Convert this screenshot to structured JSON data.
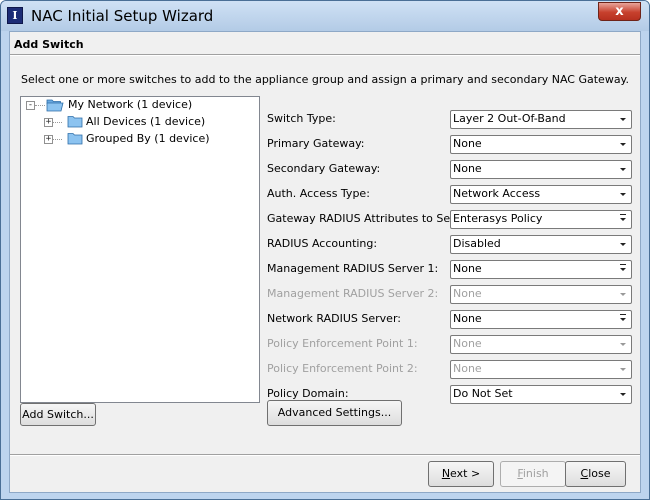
{
  "window": {
    "title": "NAC Initial Setup Wizard",
    "close_glyph": "x"
  },
  "header": {
    "title": "Add Switch"
  },
  "instructions": "Select one or more switches to add to the appliance group and assign a primary and secondary NAC Gateway.",
  "tree": {
    "root": {
      "label": "My Network (1 device)",
      "expander": "-"
    },
    "children": [
      {
        "label": "All Devices (1 device)",
        "expander": "+"
      },
      {
        "label": "Grouped By (1 device)",
        "expander": "+"
      }
    ]
  },
  "fields": [
    {
      "label": "Switch Type:",
      "value": "Layer 2 Out-Of-Band",
      "enabled": true
    },
    {
      "label": "Primary Gateway:",
      "value": "None",
      "enabled": true
    },
    {
      "label": "Secondary Gateway:",
      "value": "None",
      "enabled": true
    },
    {
      "label": "Auth. Access Type:",
      "value": "Network Access",
      "enabled": true
    },
    {
      "label": "Gateway RADIUS Attributes to Send:",
      "value": "Enterasys Policy",
      "enabled": true
    },
    {
      "label": "RADIUS Accounting:",
      "value": "Disabled",
      "enabled": true
    },
    {
      "label": "Management RADIUS Server 1:",
      "value": "None",
      "enabled": true
    },
    {
      "label": "Management RADIUS Server 2:",
      "value": "None",
      "enabled": false
    },
    {
      "label": "Network RADIUS Server:",
      "value": "None",
      "enabled": true
    },
    {
      "label": "Policy Enforcement Point 1:",
      "value": "None",
      "enabled": false
    },
    {
      "label": "Policy Enforcement Point 2:",
      "value": "None",
      "enabled": false
    },
    {
      "label": "Policy Domain:",
      "value": "Do Not Set",
      "enabled": true
    }
  ],
  "buttons": {
    "add_switch": "Add Switch...",
    "advanced_settings": "Advanced Settings...",
    "next": {
      "mnemonic": "N",
      "rest": "ext >"
    },
    "finish": {
      "mnemonic": "F",
      "rest": "inish"
    },
    "close": {
      "mnemonic": "C",
      "rest": "lose"
    }
  }
}
